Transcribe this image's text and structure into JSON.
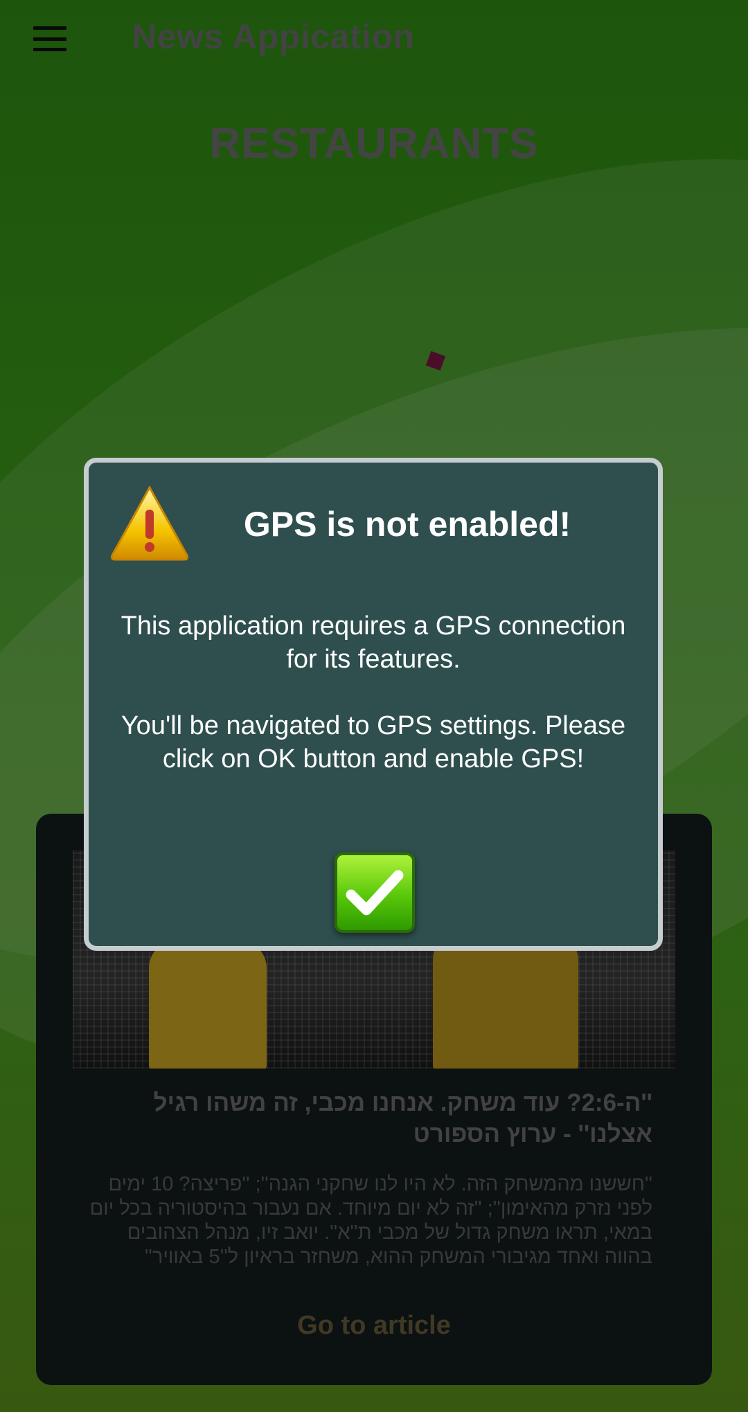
{
  "app_bar": {
    "title": "News Appication",
    "menu_icon": "menu-icon"
  },
  "section": {
    "title": "RESTAURANTS"
  },
  "news_card": {
    "image": "football-players-image",
    "headline": "''ה-2:6? עוד משחק. אנחנו מכבי, זה משהו רגיל אצלנו'' - ערוץ הספורט",
    "body": "''חששנו מהמשחק הזה. לא היו לנו שחקני הגנה''; ''פריצה? 10 ימים לפני נזרק מהאימון''; ''זה לא יום מיוחד. אם נעבור בהיסטוריה בכל יום במאי, תראו משחק גדול של מכבי ת''א''. יואב זיו, מנהל הצהובים בהווה ואחד מגיבורי המשחק ההוא, משחזר בראיון ל''5 באוויר''",
    "link_label": "Go to article"
  },
  "dialog": {
    "title": "GPS is not enabled!",
    "message_1": "This application requires a GPS connection for its features.",
    "message_2": "You'll be navigated to GPS settings. Please click on OK button and enable GPS!",
    "warning_icon": "warning-icon",
    "ok_icon": "checkmark-icon"
  },
  "colors": {
    "background_green": "#3d9a1b",
    "dialog_bg": "#2f4f4f",
    "dialog_border": "#c6cdd0",
    "card_bg": "#141d1d",
    "ok_button": "#58c70a",
    "warning_yellow": "#f5c400"
  }
}
